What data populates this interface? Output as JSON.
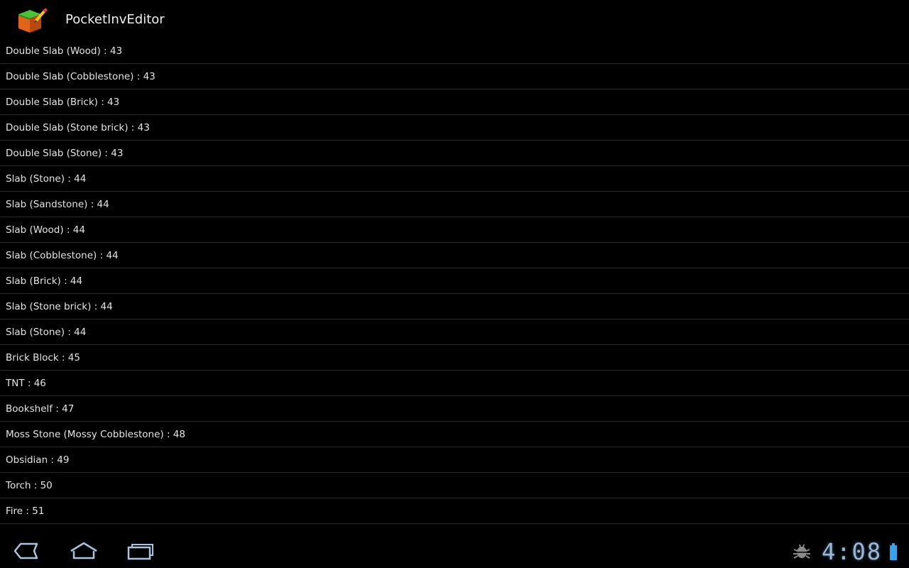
{
  "app": {
    "title": "PocketInvEditor"
  },
  "items": [
    {
      "label": "Double Slab (Wood) : 43"
    },
    {
      "label": "Double Slab (Cobblestone) : 43"
    },
    {
      "label": "Double Slab (Brick) : 43"
    },
    {
      "label": "Double Slab (Stone brick) : 43"
    },
    {
      "label": "Double Slab (Stone) : 43"
    },
    {
      "label": "Slab (Stone) : 44"
    },
    {
      "label": "Slab (Sandstone) : 44"
    },
    {
      "label": "Slab (Wood) : 44"
    },
    {
      "label": "Slab (Cobblestone) : 44"
    },
    {
      "label": "Slab (Brick) : 44"
    },
    {
      "label": "Slab (Stone brick) : 44"
    },
    {
      "label": "Slab (Stone) : 44"
    },
    {
      "label": "Brick Block : 45"
    },
    {
      "label": "TNT : 46"
    },
    {
      "label": "Bookshelf : 47"
    },
    {
      "label": "Moss Stone (Mossy Cobblestone) : 48"
    },
    {
      "label": "Obsidian : 49"
    },
    {
      "label": "Torch : 50"
    },
    {
      "label": "Fire : 51"
    }
  ],
  "system_bar": {
    "clock": "4:08",
    "icons": {
      "back": "back-icon",
      "home": "home-icon",
      "recent": "recent-apps-icon",
      "debug": "usb-debugging-icon",
      "battery": "battery-icon"
    }
  },
  "colors": {
    "background": "#000000",
    "text": "#e4e4e4",
    "divider": "#2a2a2a",
    "system_accent": "#9ab8d6"
  }
}
